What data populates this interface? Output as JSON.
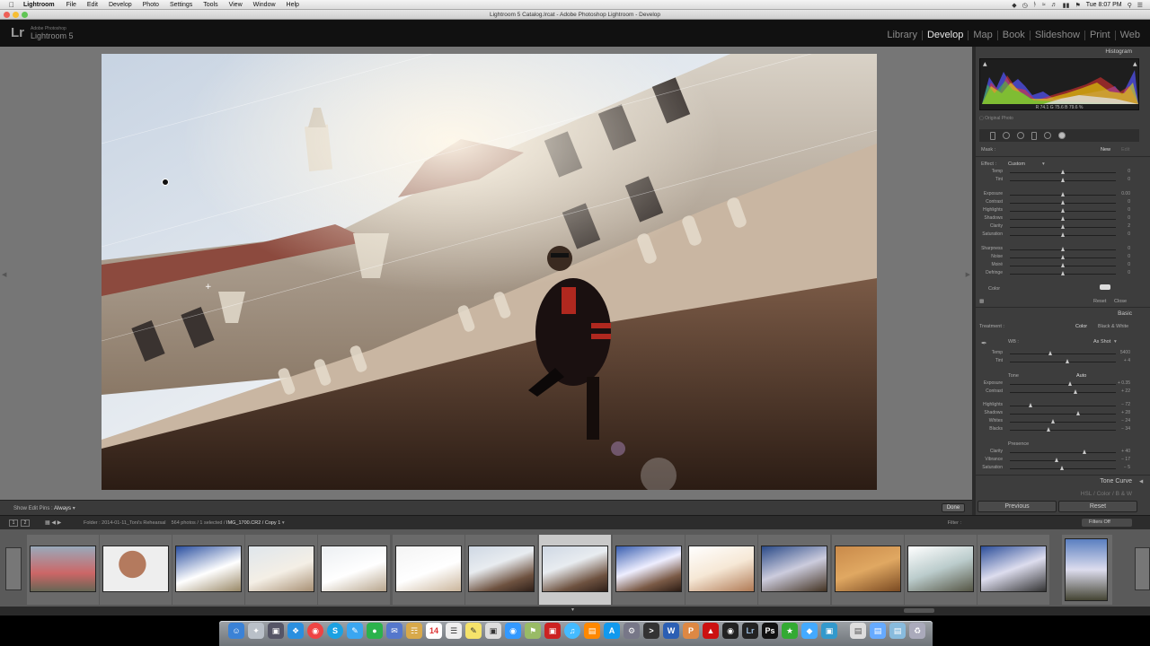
{
  "menubar": {
    "app_name": "Lightroom",
    "items": [
      "File",
      "Edit",
      "Develop",
      "Photo",
      "Settings",
      "Tools",
      "View",
      "Window",
      "Help"
    ],
    "clock": "Tue 8:07 PM"
  },
  "window": {
    "title": "Lightroom 5 Catalog.lrcat - Adobe Photoshop Lightroom - Develop"
  },
  "identity": {
    "logo": "Lr",
    "sub": "Adobe Photoshop",
    "product": "Lightroom 5"
  },
  "modules": [
    "Library",
    "Develop",
    "Map",
    "Book",
    "Slideshow",
    "Print",
    "Web"
  ],
  "active_module": "Develop",
  "toolbar": {
    "show_edit_pins_label": "Show Edit Pins :",
    "show_edit_pins_value": "Always",
    "done_label": "Done"
  },
  "right_panel": {
    "histogram_title": "Histogram",
    "readout": "R  74.1   G  75.6   B  79.6  %",
    "original_photo": "Original Photo",
    "mask_label": "Mask :",
    "mask_new": "New",
    "mask_edit": "Edit",
    "effect_label": "Effect :",
    "effect_value": "Custom",
    "brush_sliders": [
      {
        "name": "Temp",
        "value": "0"
      },
      {
        "name": "Tint",
        "value": "0"
      },
      {
        "name": "Exposure",
        "value": "0.00"
      },
      {
        "name": "Contrast",
        "value": "0"
      },
      {
        "name": "Highlights",
        "value": "0"
      },
      {
        "name": "Shadows",
        "value": "0"
      },
      {
        "name": "Clarity",
        "value": "2"
      },
      {
        "name": "Saturation",
        "value": "0"
      },
      {
        "name": "Sharpness",
        "value": "0"
      },
      {
        "name": "Noise",
        "value": "0"
      },
      {
        "name": "Moiré",
        "value": "0"
      },
      {
        "name": "Defringe",
        "value": "0"
      }
    ],
    "color_label": "Color",
    "reset_label": "Reset",
    "close_label": "Close",
    "basic_title": "Basic",
    "treatment_label": "Treatment :",
    "treatment_color": "Color",
    "treatment_bw": "Black & White",
    "wb_label": "WB :",
    "wb_value": "As Shot",
    "wb_sliders": [
      {
        "name": "Temp",
        "value": "5400"
      },
      {
        "name": "Tint",
        "value": "+ 4"
      }
    ],
    "tone_label": "Tone",
    "tone_auto": "Auto",
    "tone_sliders": [
      {
        "name": "Exposure",
        "value": "+ 0.35"
      },
      {
        "name": "Contrast",
        "value": "+ 22"
      }
    ],
    "range_sliders": [
      {
        "name": "Highlights",
        "value": "− 72"
      },
      {
        "name": "Shadows",
        "value": "+ 28"
      },
      {
        "name": "Whites",
        "value": "− 24"
      },
      {
        "name": "Blacks",
        "value": "− 34"
      }
    ],
    "presence_label": "Presence",
    "presence_sliders": [
      {
        "name": "Clarity",
        "value": "+ 40"
      },
      {
        "name": "Vibrance",
        "value": "− 17"
      },
      {
        "name": "Saturation",
        "value": "− 5"
      }
    ],
    "tone_curve_title": "Tone Curve",
    "hsl_title": "HSL / Color / B & W",
    "previous_label": "Previous",
    "reset_button_label": "Reset"
  },
  "filmstrip_bar": {
    "page1": "1",
    "page2": "2",
    "folder_label": "Folder : 2014-01-11_Toni's Rehearsal",
    "count_label": "564 photos / 1 selected /",
    "file_name": "IMG_1700.CR2 / Copy 1",
    "filter_label": "Filter :",
    "filter_value": "Filters Off"
  },
  "colors": {
    "accent_active": "#e8e8e8",
    "panel_bg": "#3d3d3d",
    "canvas_bg": "#767676",
    "filmstrip_bg": "#5a5a5a"
  }
}
